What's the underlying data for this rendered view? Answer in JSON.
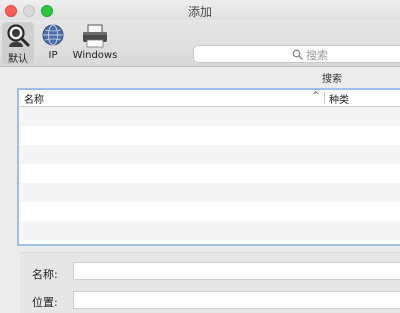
{
  "window": {
    "title": "添加"
  },
  "toolbar": {
    "items": [
      {
        "label": "默认",
        "icon": "magnifier-icon",
        "selected": true
      },
      {
        "label": "IP",
        "icon": "globe-icon",
        "selected": false
      },
      {
        "label": "Windows",
        "icon": "printer-icon",
        "selected": false
      }
    ]
  },
  "search": {
    "placeholder": "搜索",
    "caption": "搜索"
  },
  "printer_list": {
    "columns": [
      "名称",
      "种类"
    ],
    "sort_indicator": "^"
  },
  "form": {
    "name_label": "名称:",
    "location_label": "位置:"
  }
}
